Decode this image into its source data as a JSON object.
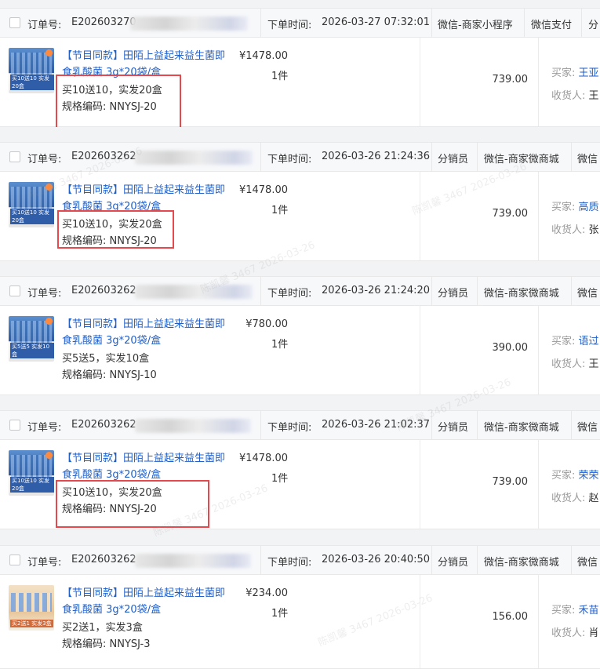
{
  "labels": {
    "order_no": "订单号:",
    "order_time": "下单时间:",
    "distributor": "分销员",
    "quantity_unit": "件",
    "buyer": "买家:",
    "receiver": "收货人:"
  },
  "watermark": "陈凯馨 3467 2026-03-26",
  "orders": [
    {
      "order_no": "E202603270",
      "order_time": "2026-03-27 07:32:01",
      "channel": "微信-商家小程序",
      "payment": "微信支付",
      "extra_tag": "分",
      "product_title": "【节目同款】田陌上益起来益生菌即食乳酸菌 3g*20袋/盒",
      "promo": "买10送10，实发20盒",
      "sku": "规格编码: NNYSJ-20",
      "price": "¥1478.00",
      "qty": "1件",
      "amount": "739.00",
      "buyer": "王亚",
      "receiver": "王",
      "thumb_caption": "买10送10 实发20盒"
    },
    {
      "order_no": "E202603262",
      "order_time": "2026-03-26 21:24:36",
      "distributor": "分销员",
      "channel": "微信-商家微商城",
      "payment": "微信",
      "product_title": "【节目同款】田陌上益起来益生菌即食乳酸菌 3g*20袋/盒",
      "promo": "买10送10，实发20盒",
      "sku": "规格编码: NNYSJ-20",
      "price": "¥1478.00",
      "qty": "1件",
      "amount": "739.00",
      "buyer": "高质",
      "receiver": "张",
      "thumb_caption": "买10送10 实发20盒"
    },
    {
      "order_no": "E202603262",
      "order_time": "2026-03-26 21:24:20",
      "distributor": "分销员",
      "channel": "微信-商家微商城",
      "payment": "微信",
      "product_title": "【节目同款】田陌上益起来益生菌即食乳酸菌 3g*20袋/盒",
      "promo": "买5送5，实发10盒",
      "sku": "规格编码: NNYSJ-10",
      "price": "¥780.00",
      "qty": "1件",
      "amount": "390.00",
      "buyer": "语过",
      "receiver": "王",
      "thumb_caption": "买5送5 实发10盒"
    },
    {
      "order_no": "E202603262",
      "order_time": "2026-03-26 21:02:37",
      "distributor": "分销员",
      "channel": "微信-商家微商城",
      "payment": "微信",
      "product_title": "【节目同款】田陌上益起来益生菌即食乳酸菌 3g*20袋/盒",
      "promo": "买10送10，实发20盒",
      "sku": "规格编码: NNYSJ-20",
      "price": "¥1478.00",
      "qty": "1件",
      "amount": "739.00",
      "buyer": "荣荣",
      "receiver": "赵",
      "thumb_caption": "买10送10 实发20盒"
    },
    {
      "order_no": "E202603262",
      "order_time": "2026-03-26 20:40:50",
      "distributor": "分销员",
      "channel": "微信-商家微商城",
      "payment": "微信",
      "product_title": "【节目同款】田陌上益起来益生菌即食乳酸菌 3g*20袋/盒",
      "promo": "买2送1，实发3盒",
      "sku": "规格编码: NNYSJ-3",
      "price": "¥234.00",
      "qty": "1件",
      "amount": "156.00",
      "buyer": "禾苗",
      "receiver": "肖",
      "thumb_caption": "买2送1 实发3盒"
    }
  ]
}
